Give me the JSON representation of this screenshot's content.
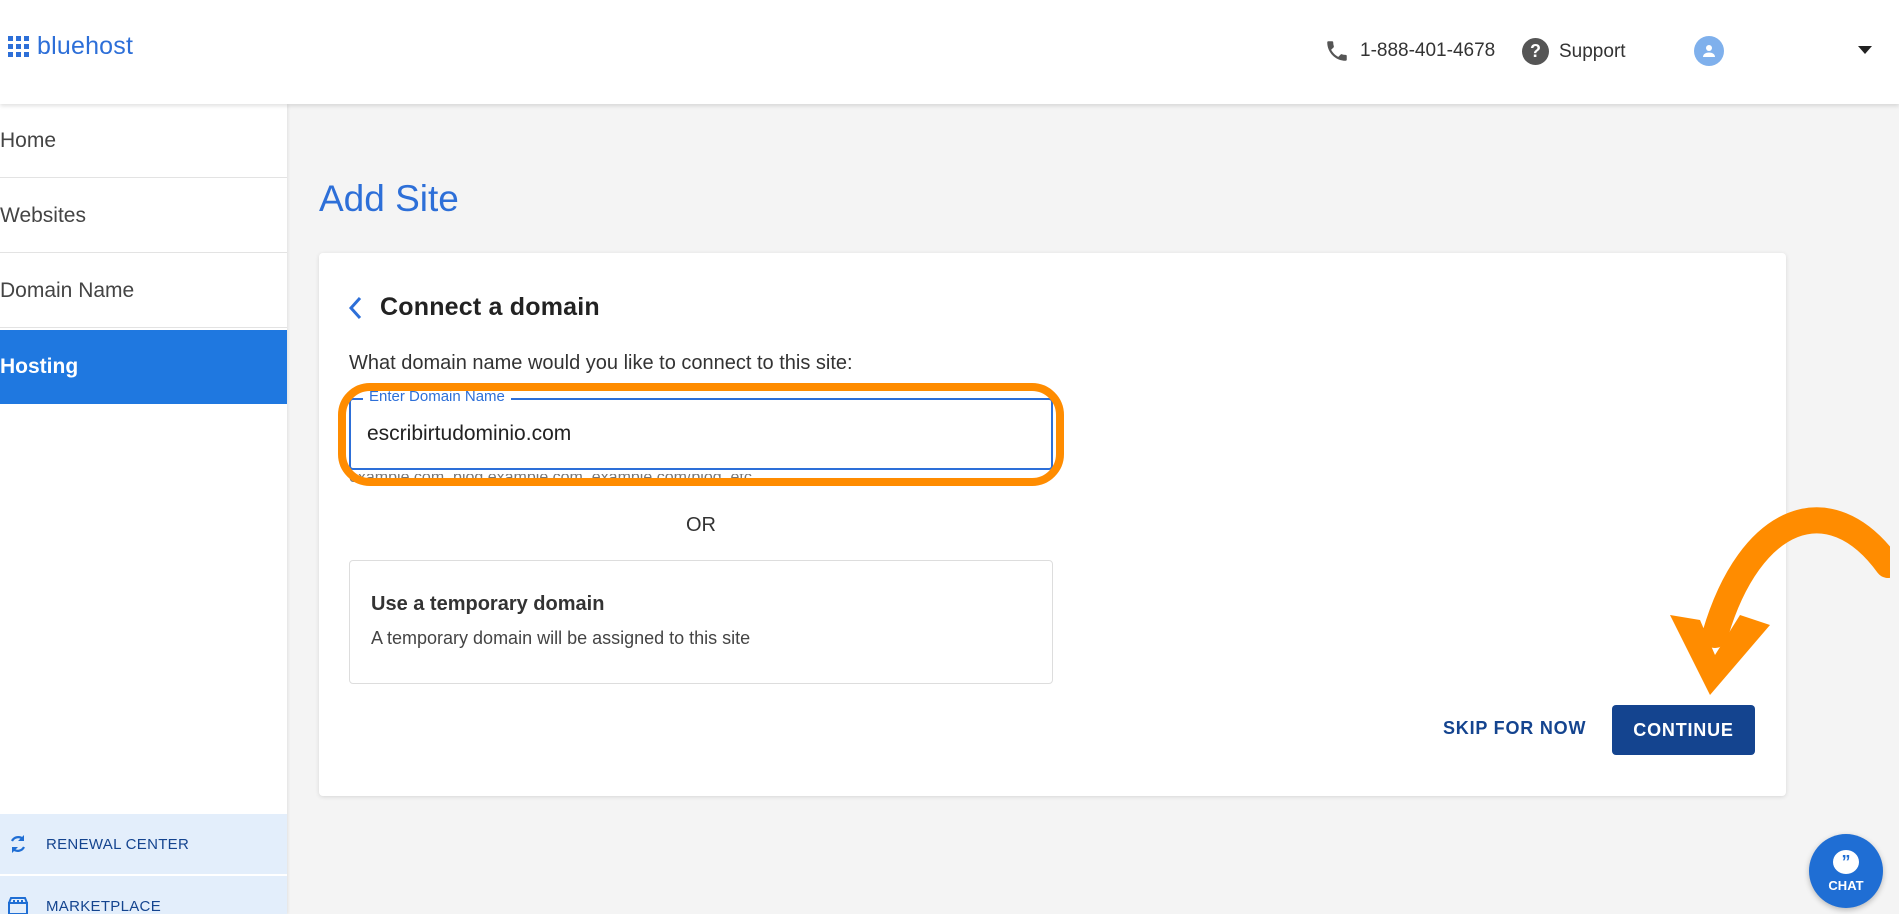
{
  "header": {
    "logo_text": "bluehost",
    "phone": "1-888-401-4678",
    "support_label": "Support"
  },
  "sidebar": {
    "items": [
      {
        "label": "Home"
      },
      {
        "label": "Websites"
      },
      {
        "label": "Domain Name"
      },
      {
        "label": "Hosting",
        "active": true
      }
    ],
    "bottom": [
      {
        "label": "RENEWAL CENTER",
        "icon": "refresh-icon"
      },
      {
        "label": "MARKETPLACE",
        "icon": "store-icon"
      }
    ]
  },
  "main": {
    "page_title": "Add Site",
    "card": {
      "heading": "Connect a domain",
      "question": "What domain name would you like to connect to this site:",
      "field_label": "Enter Domain Name",
      "field_value": "escribirtudominio.com",
      "field_helper": "example.com, blog.example.com, example.com/blog, etc.",
      "or_text": "OR",
      "temp_title": "Use a temporary domain",
      "temp_desc": "A temporary domain will be assigned to this site",
      "skip_label": "SKIP FOR NOW",
      "continue_label": "CONTINUE"
    }
  },
  "chat": {
    "label": "CHAT"
  },
  "colors": {
    "brand_blue": "#2d6fd8",
    "active_nav": "#1f78e0",
    "dark_button": "#14448f",
    "highlight_orange": "#ff8c00"
  }
}
